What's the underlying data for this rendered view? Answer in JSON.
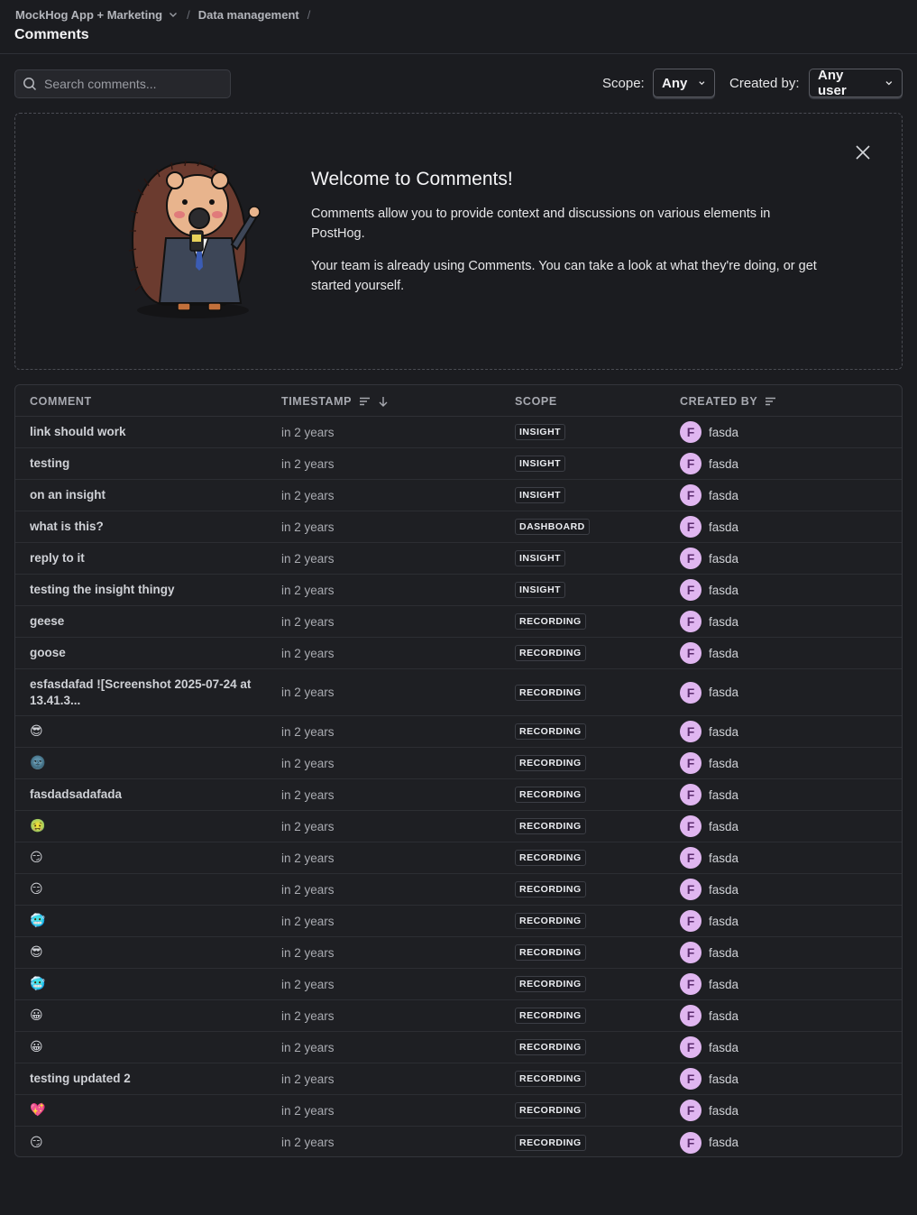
{
  "breadcrumb": {
    "project": "MockHog App + Marketing",
    "section": "Data management"
  },
  "page": {
    "title": "Comments"
  },
  "search": {
    "placeholder": "Search comments..."
  },
  "filters": {
    "scope_label": "Scope:",
    "scope_value": "Any",
    "created_by_label": "Created by:",
    "created_by_value": "Any user"
  },
  "welcome": {
    "title": "Welcome to Comments!",
    "paragraph1": "Comments allow you to provide context and discussions on various elements in PostHog.",
    "paragraph2": "Your team is already using Comments. You can take a look at what they're doing, or get started yourself."
  },
  "table": {
    "headers": {
      "comment": "COMMENT",
      "timestamp": "TIMESTAMP",
      "scope": "SCOPE",
      "created_by": "CREATED BY"
    },
    "rows": [
      {
        "comment": "link should work",
        "timestamp": "in 2 years",
        "scope": "INSIGHT",
        "user": "fasda",
        "initial": "F"
      },
      {
        "comment": "testing",
        "timestamp": "in 2 years",
        "scope": "INSIGHT",
        "user": "fasda",
        "initial": "F"
      },
      {
        "comment": "on an insight",
        "timestamp": "in 2 years",
        "scope": "INSIGHT",
        "user": "fasda",
        "initial": "F"
      },
      {
        "comment": "what is this?",
        "timestamp": "in 2 years",
        "scope": "DASHBOARD",
        "user": "fasda",
        "initial": "F"
      },
      {
        "comment": "reply to it",
        "timestamp": "in 2 years",
        "scope": "INSIGHT",
        "user": "fasda",
        "initial": "F"
      },
      {
        "comment": "testing the insight thingy",
        "timestamp": "in 2 years",
        "scope": "INSIGHT",
        "user": "fasda",
        "initial": "F"
      },
      {
        "comment": "geese",
        "timestamp": "in 2 years",
        "scope": "RECORDING",
        "user": "fasda",
        "initial": "F"
      },
      {
        "comment": "goose",
        "timestamp": "in 2 years",
        "scope": "RECORDING",
        "user": "fasda",
        "initial": "F"
      },
      {
        "comment": "esfasdafad ![Screenshot 2025-07-24 at 13.41.3...",
        "timestamp": "in 2 years",
        "scope": "RECORDING",
        "user": "fasda",
        "initial": "F",
        "tall": true
      },
      {
        "comment": "😎",
        "timestamp": "in 2 years",
        "scope": "RECORDING",
        "user": "fasda",
        "initial": "F",
        "emoji": true
      },
      {
        "comment": "🌚",
        "timestamp": "in 2 years",
        "scope": "RECORDING",
        "user": "fasda",
        "initial": "F",
        "emoji": true
      },
      {
        "comment": "fasdadsadafada",
        "timestamp": "in 2 years",
        "scope": "RECORDING",
        "user": "fasda",
        "initial": "F"
      },
      {
        "comment": "🤢",
        "timestamp": "in 2 years",
        "scope": "RECORDING",
        "user": "fasda",
        "initial": "F",
        "emoji": true
      },
      {
        "comment": "😏",
        "timestamp": "in 2 years",
        "scope": "RECORDING",
        "user": "fasda",
        "initial": "F",
        "emoji": true
      },
      {
        "comment": "😏",
        "timestamp": "in 2 years",
        "scope": "RECORDING",
        "user": "fasda",
        "initial": "F",
        "emoji": true
      },
      {
        "comment": "🥶",
        "timestamp": "in 2 years",
        "scope": "RECORDING",
        "user": "fasda",
        "initial": "F",
        "emoji": true
      },
      {
        "comment": "😎",
        "timestamp": "in 2 years",
        "scope": "RECORDING",
        "user": "fasda",
        "initial": "F",
        "emoji": true
      },
      {
        "comment": "🥶",
        "timestamp": "in 2 years",
        "scope": "RECORDING",
        "user": "fasda",
        "initial": "F",
        "emoji": true
      },
      {
        "comment": "😀",
        "timestamp": "in 2 years",
        "scope": "RECORDING",
        "user": "fasda",
        "initial": "F",
        "emoji": true
      },
      {
        "comment": "😀",
        "timestamp": "in 2 years",
        "scope": "RECORDING",
        "user": "fasda",
        "initial": "F",
        "emoji": true
      },
      {
        "comment": "testing updated 2",
        "timestamp": "in 2 years",
        "scope": "RECORDING",
        "user": "fasda",
        "initial": "F"
      },
      {
        "comment": "💖",
        "timestamp": "in 2 years",
        "scope": "RECORDING",
        "user": "fasda",
        "initial": "F",
        "emoji": true
      },
      {
        "comment": "😏",
        "timestamp": "in 2 years",
        "scope": "RECORDING",
        "user": "fasda",
        "initial": "F",
        "emoji": true
      }
    ]
  },
  "colors": {
    "background": "#1b1c20",
    "avatar": "#e0b6f0",
    "avatar_text": "#5a2b6d"
  },
  "icons": {
    "search": "search-icon",
    "close": "close-icon",
    "sort": "sort-icon",
    "chevron": "chevron-down-icon"
  }
}
